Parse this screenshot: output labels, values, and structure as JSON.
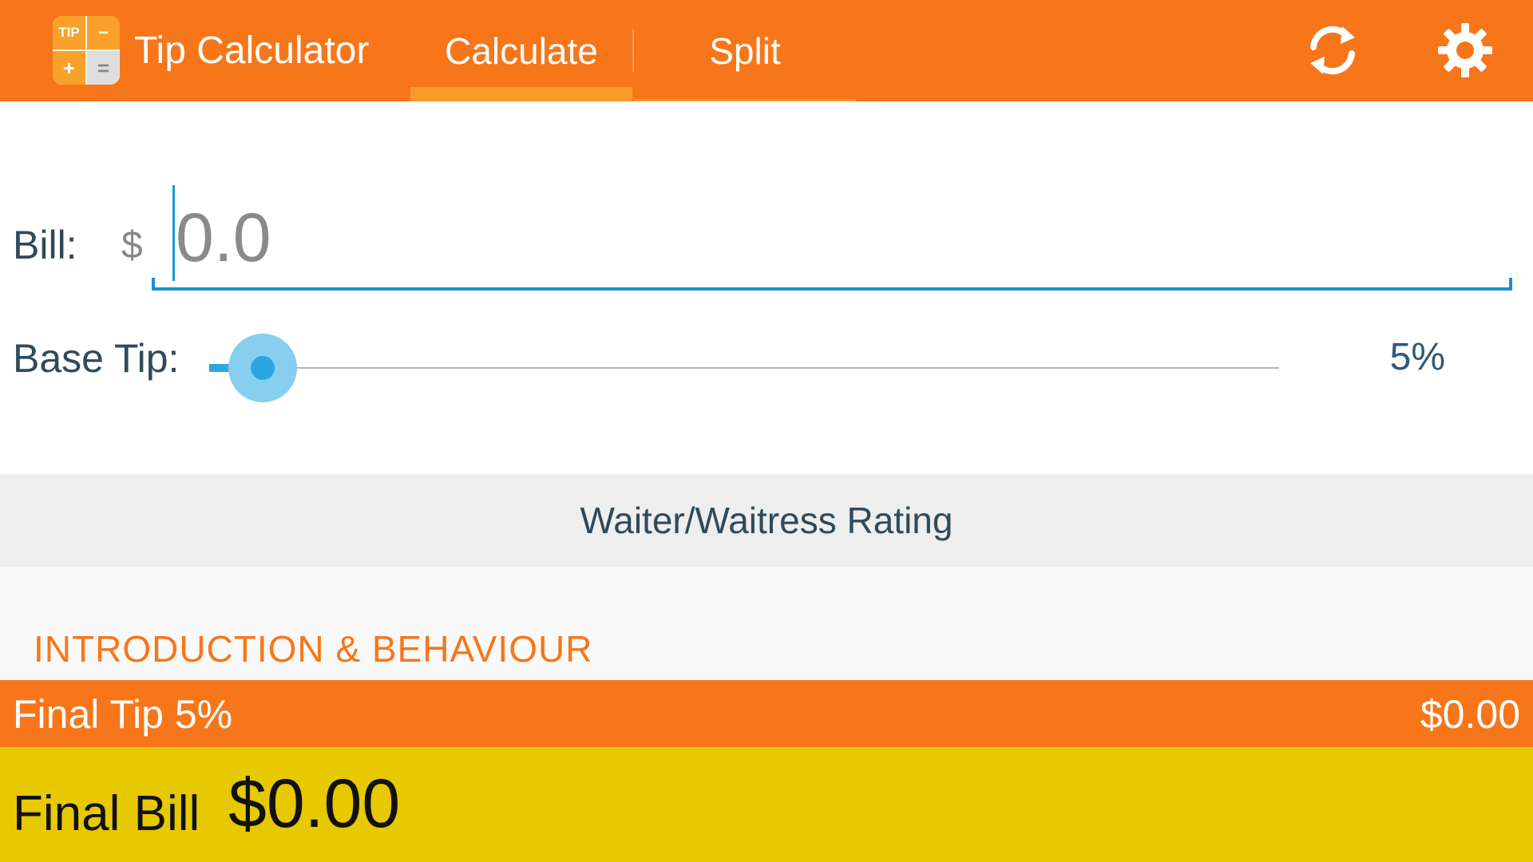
{
  "app": {
    "title": "Tip Calculator",
    "logo": {
      "top_left": "TIP",
      "top_right": "−",
      "bottom_left": "+",
      "bottom_right": "="
    }
  },
  "tabs": [
    {
      "label": "Calculate",
      "active": true
    },
    {
      "label": "Split",
      "active": false
    }
  ],
  "toolbar": {
    "refresh_icon": "refresh-icon",
    "settings_icon": "gear-icon"
  },
  "bill": {
    "label": "Bill:",
    "currency": "$",
    "placeholder": "0.0",
    "value": ""
  },
  "base_tip": {
    "label": "Base Tip:",
    "value_percent": 5,
    "display": "5%"
  },
  "rating": {
    "header": "Waiter/Waitress Rating",
    "section_title": "INTRODUCTION & BEHAVIOUR"
  },
  "final_tip": {
    "label": "Final Tip 5%",
    "amount": "$0.00"
  },
  "final_bill": {
    "label": "Final Bill",
    "amount": "$0.00"
  },
  "colors": {
    "primary": "#f7761a",
    "accent": "#2aa7e0",
    "final_bill_bg": "#e6c900"
  }
}
